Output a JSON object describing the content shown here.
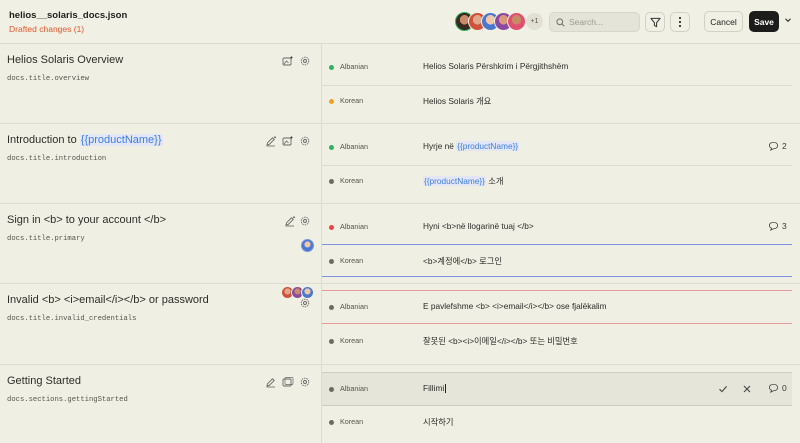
{
  "header": {
    "file_name": "helios__solaris_docs.json",
    "draft_status": "Drafted changes (1)",
    "avatars_more": "+1",
    "search_placeholder": "Search...",
    "cancel_label": "Cancel",
    "save_label": "Save"
  },
  "colors": {
    "accent_orange": "#e0592b",
    "placeholder_blue": "#3f7fe0",
    "status_green": "#2fb35c",
    "status_orange": "#f0a020",
    "status_red": "#e84545",
    "status_gray": "#6b6b66"
  },
  "sections": [
    {
      "title": "Helios Solaris Overview",
      "key": "docs.title.overview",
      "icons": [
        "translate-icon",
        "settings-icon"
      ],
      "rows": [
        {
          "lang": "Albanian",
          "status": "green",
          "value": "Helios Solaris Përshkrim i Përgjithshëm"
        },
        {
          "lang": "Korean",
          "status": "orange",
          "value": "Helios Solaris 개요"
        }
      ]
    },
    {
      "title_prefix": "Introduction to",
      "title_placeholder": "{{productName}}",
      "key": "docs.title.introduction",
      "rows": [
        {
          "lang": "Albanian",
          "status": "green",
          "value_prefix": "Hyrje në",
          "value_placeholder": "{{productName}}",
          "comments": "2"
        },
        {
          "lang": "Korean",
          "status": "gray",
          "value_placeholder": "{{productName}}",
          "value_suffix": "소개"
        }
      ]
    },
    {
      "title": "Sign in <b> to your account </b>",
      "key": "docs.title.primary",
      "rows": [
        {
          "lang": "Albanian",
          "status": "red",
          "value": "Hyni <b>në llogarinë tuaj </b>",
          "comments": "3"
        },
        {
          "lang": "Korean",
          "status": "gray",
          "value": "<b>계정에</b> 로그인"
        }
      ]
    },
    {
      "title": "Invalid <b> <i>email</i></b> or password",
      "key": "docs.title.invalid_credentials",
      "rows": [
        {
          "lang": "Albanian",
          "status": "gray",
          "value": "E pavlefshme <b> <i>email</i></b> ose fjalëkalim"
        },
        {
          "lang": "Korean",
          "status": "gray",
          "value": "잘못된 <b><i>이메일</i></b> 또는 비밀번호"
        }
      ]
    },
    {
      "title": "Getting Started",
      "key": "docs.sections.gettingStarted",
      "rows": [
        {
          "lang": "Albanian",
          "status": "gray",
          "value": "Fillimi",
          "comments": "0"
        },
        {
          "lang": "Korean",
          "status": "gray",
          "value": "시작하기"
        }
      ]
    }
  ]
}
